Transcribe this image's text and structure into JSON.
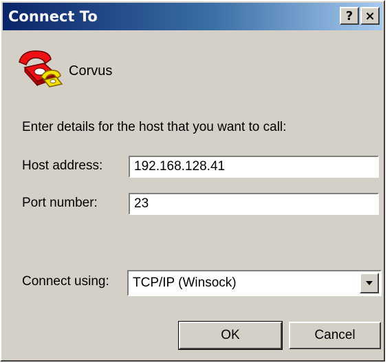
{
  "window": {
    "title": "Connect To",
    "help_button": "?",
    "close_button": "×"
  },
  "connection": {
    "icon": "telephone-icon",
    "name": "Corvus"
  },
  "prompt": "Enter details for the host that you want to call:",
  "host": {
    "label": "Host address:",
    "value": "192.168.128.41"
  },
  "port": {
    "label": "Port number:",
    "value": "23"
  },
  "connect_using": {
    "label": "Connect using:",
    "selected": "TCP/IP (Winsock)"
  },
  "buttons": {
    "ok": "OK",
    "cancel": "Cancel"
  },
  "colors": {
    "dialog_bg": "#d4d0c8",
    "titlebar_start": "#0a246a",
    "titlebar_end": "#a6caf0"
  }
}
